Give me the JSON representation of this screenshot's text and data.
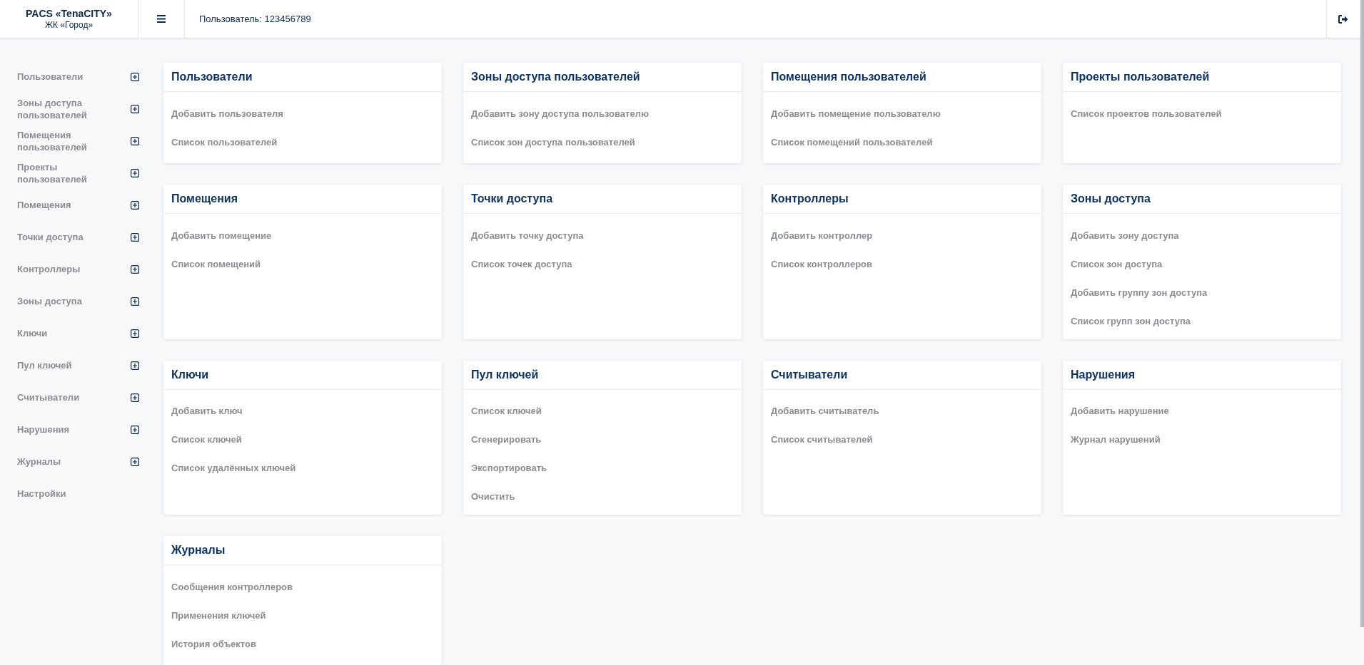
{
  "header": {
    "brand_title": "PACS «TenaCITY»",
    "brand_subtitle": "ЖК «Город»",
    "user": "Пользователь: 123456789"
  },
  "sidebar": {
    "items": [
      {
        "label": "Пользователи",
        "has_submenu": true
      },
      {
        "label": "Зоны доступа пользователей",
        "has_submenu": true
      },
      {
        "label": "Помещения пользователей",
        "has_submenu": true
      },
      {
        "label": "Проекты пользователей",
        "has_submenu": true
      },
      {
        "label": "Помещения",
        "has_submenu": true
      },
      {
        "label": "Точки доступа",
        "has_submenu": true
      },
      {
        "label": "Контроллеры",
        "has_submenu": true
      },
      {
        "label": "Зоны доступа",
        "has_submenu": true
      },
      {
        "label": "Ключи",
        "has_submenu": true
      },
      {
        "label": "Пул ключей",
        "has_submenu": true
      },
      {
        "label": "Считыватели",
        "has_submenu": true
      },
      {
        "label": "Нарушения",
        "has_submenu": true
      },
      {
        "label": "Журналы",
        "has_submenu": true
      },
      {
        "label": "Настройки",
        "has_submenu": false
      }
    ]
  },
  "cards": [
    {
      "title": "Пользователи",
      "links": [
        "Добавить пользователя",
        "Список пользователей"
      ]
    },
    {
      "title": "Зоны доступа пользователей",
      "links": [
        "Добавить зону доступа пользователю",
        "Список зон доступа пользователей"
      ]
    },
    {
      "title": "Помещения пользователей",
      "links": [
        "Добавить помещение пользователю",
        "Список помещений пользователей"
      ]
    },
    {
      "title": "Проекты пользователей",
      "links": [
        "Список проектов пользователей"
      ]
    },
    {
      "title": "Помещения",
      "links": [
        "Добавить помещение",
        "Список помещений"
      ]
    },
    {
      "title": "Точки доступа",
      "links": [
        "Добавить точку доступа",
        "Список точек доступа"
      ]
    },
    {
      "title": "Контроллеры",
      "links": [
        "Добавить контроллер",
        "Список контроллеров"
      ]
    },
    {
      "title": "Зоны доступа",
      "links": [
        "Добавить зону доступа",
        "Список зон доступа",
        "Добавить группу зон доступа",
        "Список групп зон доступа"
      ]
    },
    {
      "title": "Ключи",
      "links": [
        "Добавить ключ",
        "Список ключей",
        "Список удалённых ключей"
      ]
    },
    {
      "title": "Пул ключей",
      "links": [
        "Список ключей",
        "Сгенерировать",
        "Экспортировать",
        "Очистить"
      ]
    },
    {
      "title": "Считыватели",
      "links": [
        "Добавить считыватель",
        "Список считывателей"
      ]
    },
    {
      "title": "Нарушения",
      "links": [
        "Добавить нарушение",
        "Журнал нарушений"
      ]
    },
    {
      "title": "Журналы",
      "links": [
        "Сообщения контроллеров",
        "Применения ключей",
        "История объектов"
      ]
    }
  ]
}
